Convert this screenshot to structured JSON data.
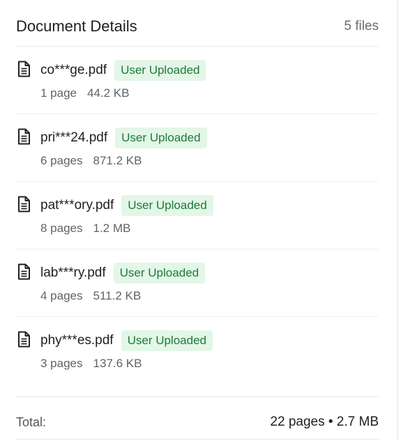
{
  "panel": {
    "title": "Document Details",
    "file_count": "5 files"
  },
  "files": [
    {
      "name": "co***ge.pdf",
      "badge": "User Uploaded",
      "pages": "1 page",
      "size": "44.2 KB",
      "icon": "document-icon"
    },
    {
      "name": "pri***24.pdf",
      "badge": "User Uploaded",
      "pages": "6 pages",
      "size": "871.2 KB",
      "icon": "document-icon"
    },
    {
      "name": "pat***ory.pdf",
      "badge": "User Uploaded",
      "pages": "8 pages",
      "size": "1.2 MB",
      "icon": "document-icon"
    },
    {
      "name": "lab***ry.pdf",
      "badge": "User Uploaded",
      "pages": "4 pages",
      "size": "511.2 KB",
      "icon": "document-icon"
    },
    {
      "name": "phy***es.pdf",
      "badge": "User Uploaded",
      "pages": "3 pages",
      "size": "137.6 KB",
      "icon": "document-icon"
    }
  ],
  "summary": {
    "label": "Total:",
    "value": "22 pages • 2.7 MB"
  },
  "colors": {
    "badge_background": "#e3f6e7",
    "badge_text": "#1e7a3a",
    "secondary_text": "#5f6368"
  }
}
